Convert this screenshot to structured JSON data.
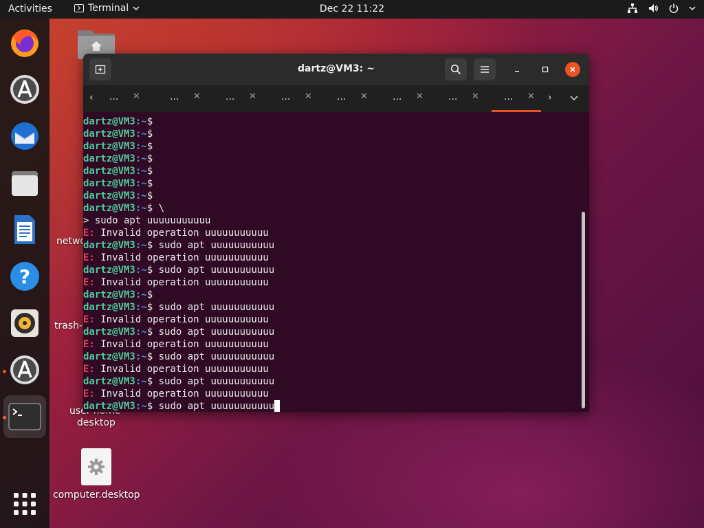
{
  "topbar": {
    "activities": "Activities",
    "app_name": "Terminal",
    "clock": "Dec 22  11:22"
  },
  "dock": {
    "items": [
      {
        "name": "firefox-icon"
      },
      {
        "name": "software-updater-icon"
      },
      {
        "name": "thunderbird-icon"
      },
      {
        "name": "files-icon"
      },
      {
        "name": "libreoffice-writer-icon"
      },
      {
        "name": "help-icon"
      },
      {
        "name": "rhythmbox-icon"
      },
      {
        "name": "software-center-icon"
      },
      {
        "name": "terminal-icon"
      },
      {
        "name": "show-apps-icon"
      }
    ],
    "accent": "#e95420"
  },
  "desktop": {
    "labels": [
      {
        "text": "netwo"
      },
      {
        "text": "trash-d"
      },
      {
        "text": "user-home-"
      },
      {
        "text": "desktop"
      },
      {
        "text": "computer.desktop"
      }
    ]
  },
  "terminal": {
    "title": "dartz@VM3: ~",
    "tabs": [
      {
        "label": "..."
      },
      {
        "label": "..."
      },
      {
        "label": "..."
      },
      {
        "label": "..."
      },
      {
        "label": "..."
      },
      {
        "label": "..."
      },
      {
        "label": "..."
      },
      {
        "label": "..."
      }
    ],
    "prompt_user": "dartz@VM3",
    "prompt_path": ":~",
    "prompt_symbol": "$",
    "error_tag": "E:",
    "lines": [
      {
        "kind": "prompt",
        "cmd": ""
      },
      {
        "kind": "prompt",
        "cmd": ""
      },
      {
        "kind": "prompt",
        "cmd": ""
      },
      {
        "kind": "prompt",
        "cmd": ""
      },
      {
        "kind": "prompt",
        "cmd": ""
      },
      {
        "kind": "prompt",
        "cmd": ""
      },
      {
        "kind": "prompt",
        "cmd": ""
      },
      {
        "kind": "prompt",
        "cmd": " \\"
      },
      {
        "kind": "plain",
        "text": "> sudo apt uuuuuuuuuuu"
      },
      {
        "kind": "error",
        "text": " Invalid operation uuuuuuuuuuu"
      },
      {
        "kind": "prompt",
        "cmd": " sudo apt uuuuuuuuuuu"
      },
      {
        "kind": "error",
        "text": " Invalid operation uuuuuuuuuuu"
      },
      {
        "kind": "prompt",
        "cmd": " sudo apt uuuuuuuuuuu"
      },
      {
        "kind": "error",
        "text": " Invalid operation uuuuuuuuuuu"
      },
      {
        "kind": "prompt",
        "cmd": ""
      },
      {
        "kind": "prompt",
        "cmd": " sudo apt uuuuuuuuuuu"
      },
      {
        "kind": "error",
        "text": " Invalid operation uuuuuuuuuuu"
      },
      {
        "kind": "prompt",
        "cmd": " sudo apt uuuuuuuuuuu"
      },
      {
        "kind": "error",
        "text": " Invalid operation uuuuuuuuuuu"
      },
      {
        "kind": "prompt",
        "cmd": " sudo apt uuuuuuuuuuu"
      },
      {
        "kind": "error",
        "text": " Invalid operation uuuuuuuuuuu"
      },
      {
        "kind": "prompt",
        "cmd": " sudo apt uuuuuuuuuuu"
      },
      {
        "kind": "error",
        "text": " Invalid operation uuuuuuuuuuu"
      },
      {
        "kind": "prompt",
        "cmd": " sudo apt uuuuuuuuuuu",
        "cursor": true
      }
    ],
    "colors": {
      "background": "#300a24",
      "user": "#4ec99a",
      "path": "#5d8ed6",
      "error": "#e0405a"
    }
  }
}
